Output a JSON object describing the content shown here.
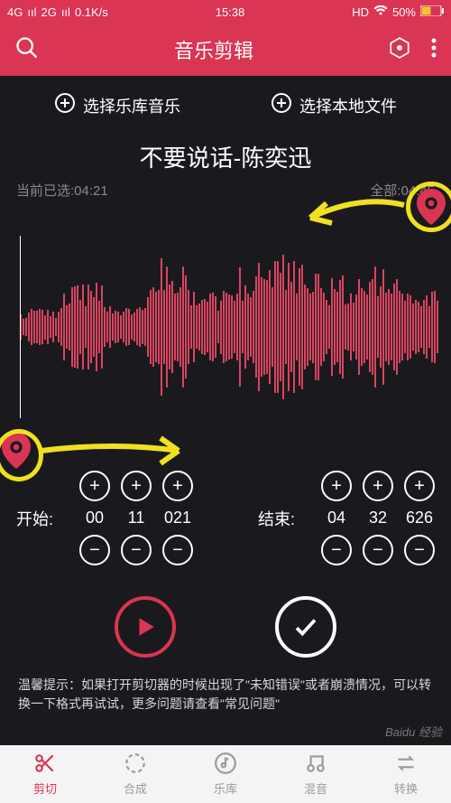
{
  "status": {
    "net1": "4G",
    "net2": "2G",
    "speed": "0.1K/s",
    "time": "15:38",
    "hd": "HD",
    "battery": "50%"
  },
  "header": {
    "title": "音乐剪辑"
  },
  "sources": {
    "library": "选择乐库音乐",
    "local": "选择本地文件"
  },
  "song": {
    "title": "不要说话-陈奕迅"
  },
  "times": {
    "selected_label": "当前已选:",
    "selected": "04:21",
    "total_label": "全部:",
    "total": "04:45"
  },
  "start": {
    "label": "开始:",
    "mm": "00",
    "ss": "11",
    "ms": "021"
  },
  "end": {
    "label": "结束:",
    "mm": "04",
    "ss": "32",
    "ms": "626"
  },
  "hint": "温馨提示：如果打开剪切器的时候出现了\"未知错误\"或者崩溃情况，可以转换一下格式再试试，更多问题请查看\"常见问题\"",
  "nav": {
    "cut": "剪切",
    "merge": "合成",
    "library": "乐库",
    "mix": "混音",
    "convert": "转换"
  },
  "watermark": "Baidu 经验"
}
